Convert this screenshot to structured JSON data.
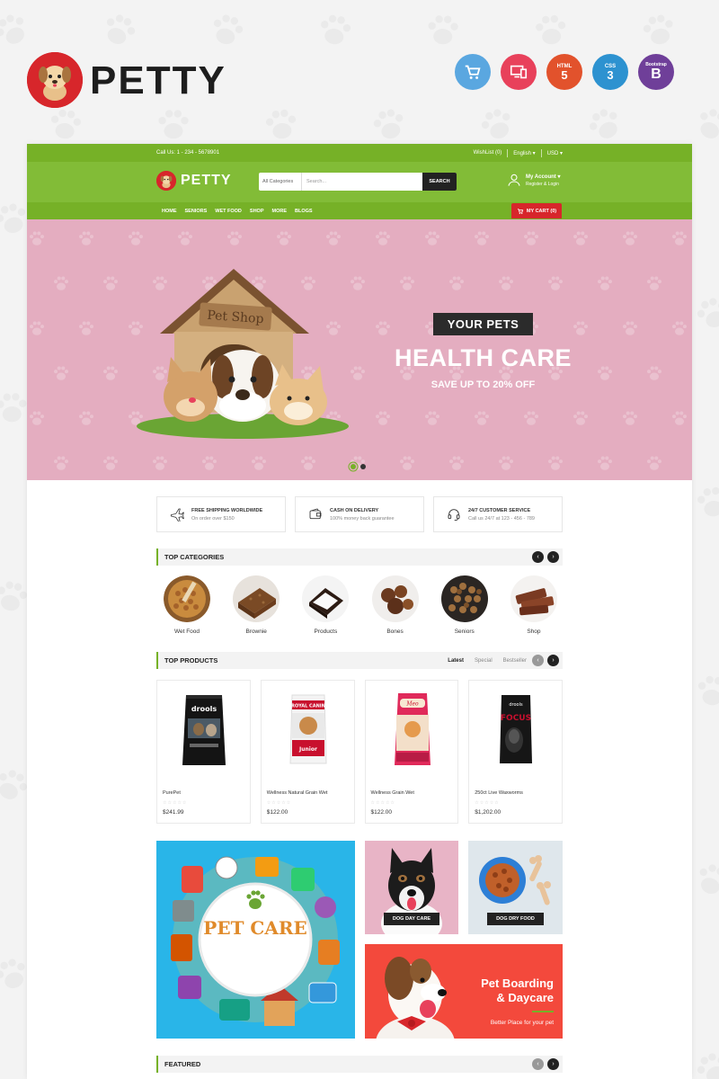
{
  "brand": {
    "name": "PETTY",
    "tech_badges": [
      {
        "icon": "cart-icon",
        "color": "#5aa7e0"
      },
      {
        "icon": "responsive-icon",
        "color": "#e8415b"
      },
      {
        "icon": "html5-icon",
        "label": "HTML",
        "color": "#e2522c"
      },
      {
        "icon": "css3-icon",
        "label": "CSS",
        "color": "#2d92d0"
      },
      {
        "icon": "bootstrap-icon",
        "label": "Bootstrap",
        "letter": "B",
        "color": "#6f3f99"
      }
    ]
  },
  "topbar": {
    "call": "Call Us: 1 - 234 - 5678901",
    "wishlist": "WishList (0)",
    "language": "English ▾",
    "currency": "USD ▾"
  },
  "header": {
    "logo_text": "PETTY",
    "search": {
      "category": "All Categories",
      "placeholder": "Search...",
      "button": "SEARCH"
    },
    "account": {
      "title": "My Account ▾",
      "subtitle": "Register & Login"
    }
  },
  "nav": {
    "items": [
      "HOME",
      "SENIORS",
      "WET FOOD",
      "SHOP",
      "MORE",
      "BLOGS"
    ],
    "cart": "MY CART (0)"
  },
  "hero": {
    "pill": "YOUR PETS",
    "title": "HEALTH CARE",
    "sub_prefix": "SAVE UP TO",
    "sub_highlight": "20% OFF",
    "sign": "Pet Shop",
    "slides": 2,
    "active_slide": 1
  },
  "services": [
    {
      "icon": "plane-icon",
      "title": "FREE SHIPPING WORLDWIDE",
      "text": "On order over $150"
    },
    {
      "icon": "wallet-icon",
      "title": "CASH ON DELIVERY",
      "text": "100% money back guarantee"
    },
    {
      "icon": "headset-icon",
      "title": "24/7 CUSTOMER SERVICE",
      "text": "Call us 24/7 at 123 - 456 - 789"
    }
  ],
  "categories": {
    "title": "TOP CATEGORIES",
    "items": [
      "Wet Food",
      "Brownie",
      "Products",
      "Bones",
      "Seniors",
      "Shop"
    ]
  },
  "products": {
    "title": "TOP PRODUCTS",
    "tabs": [
      "Latest",
      "Special",
      "Bestseller"
    ],
    "items": [
      {
        "name": "PurePet",
        "price": "$241.99",
        "rating": 0
      },
      {
        "name": "Wellness Natural Grain Wet",
        "price": "$122.00",
        "rating": 0
      },
      {
        "name": "Wellness Grain Wet",
        "price": "$122.00",
        "rating": 0
      },
      {
        "name": "250ct Live Waxworms",
        "price": "$1,202.00",
        "rating": 0
      }
    ],
    "package_labels": [
      "drools",
      "ROYAL CANIN",
      "Junior",
      "Meo",
      "drools",
      "FOCUS"
    ]
  },
  "banners": {
    "pet_care": "PET CARE",
    "dog_day_care": "DOG DAY CARE",
    "dog_dry_food": "DOG DRY FOOD",
    "boarding_title_1": "Pet Boarding",
    "boarding_title_2": "& Daycare",
    "boarding_sub": "Better Place for your pet"
  },
  "featured": {
    "title": "FEATURED"
  },
  "colors": {
    "green": "#82bc37",
    "dark_green": "#76b127",
    "red": "#d7262b",
    "hero_pink": "#e4adc0",
    "sky": "#29b5e8"
  }
}
